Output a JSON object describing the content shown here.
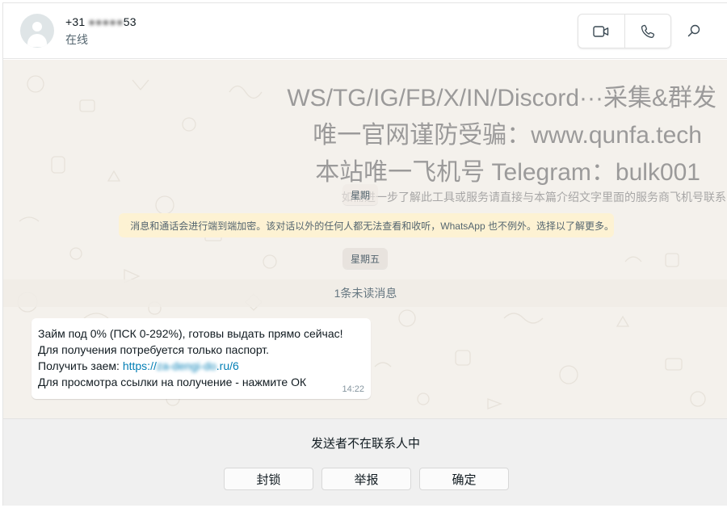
{
  "header": {
    "contact_name_prefix": "+31 ",
    "contact_name_masked": "6",
    "contact_name_suffix": "53",
    "status": "在线",
    "icons": [
      "avatar",
      "video-call-icon",
      "voice-call-icon",
      "search-icon"
    ]
  },
  "watermark": {
    "line1": "WS/TG/IG/FB/X/IN/Discord···采集&群发",
    "line2": "唯一官网谨防受骗：www.qunfa.tech",
    "line3": "本站唯一飞机号 Telegram：bulk001",
    "line4": "如需进一步了解此工具或服务请直接与本篇介绍文字里面的服务商飞机号联系"
  },
  "chat": {
    "date_pill_1": "星期",
    "encryption_notice": "消息和通话会进行端到端加密。该对话以外的任何人都无法查看和收听，WhatsApp 也不例外。选择以了解更多。",
    "date_pill_2": "星期五",
    "unread_label": "1条未读消息",
    "message": {
      "line1": "Займ под 0% (ПСК 0-292%), готовы выдать прямо сейчас!",
      "line2": "Для получения потребуется только паспорт.",
      "line3_prefix": "Получить заем: ",
      "link_start": "https://",
      "link_masked": "za-dengi-do",
      "link_end": ".ru/6",
      "line4": "Для просмотра ссылки на получение - нажмите ОК",
      "time": "14:22"
    }
  },
  "footer": {
    "notice": "发送者不在联系人中",
    "block_label": "封锁",
    "report_label": "举报",
    "ok_label": "确定"
  },
  "colors": {
    "chat_background": "#f4f1ec",
    "encryption_background": "#fdf2d3",
    "link": "#027eb5",
    "footer_background": "#f0f0f0"
  }
}
